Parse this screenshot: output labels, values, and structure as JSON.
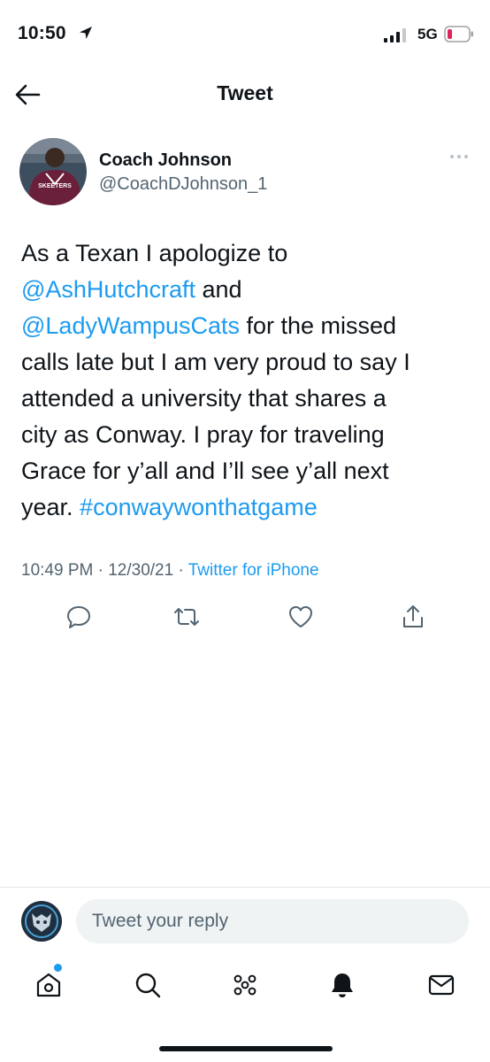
{
  "status_bar": {
    "time": "10:50",
    "network": "5G",
    "colors": {
      "battery_low": "#e0245e"
    }
  },
  "header": {
    "title": "Tweet"
  },
  "tweet": {
    "author_name": "Coach Johnson",
    "author_handle": "@CoachDJohnson_1",
    "avatar_text": "SKEETERS",
    "lines": [
      [
        {
          "t": "As a Texan I apologize to"
        }
      ],
      [
        {
          "t": "@AshHutchcraft",
          "link": true
        },
        {
          "t": " and"
        }
      ],
      [
        {
          "t": "@LadyWampusCats",
          "link": true
        },
        {
          "t": " for the missed"
        }
      ],
      [
        {
          "t": "calls late but I am very proud to say I"
        }
      ],
      [
        {
          "t": "attended a university that shares a"
        }
      ],
      [
        {
          "t": "city as Conway.  I pray for traveling"
        }
      ],
      [
        {
          "t": "Grace for y’all and I’ll see y’all next"
        }
      ],
      [
        {
          "t": "year. "
        },
        {
          "t": "#conwaywonthatgame",
          "link": true
        }
      ]
    ],
    "timestamp": "10:49 PM · 12/30/21 · ",
    "source": "Twitter for iPhone"
  },
  "actions": [
    "reply-icon",
    "retweet-icon",
    "like-icon",
    "share-icon"
  ],
  "reply_bar": {
    "placeholder": "Tweet your reply"
  },
  "tabs": [
    "home-icon",
    "search-icon",
    "spaces-icon",
    "notifications-icon",
    "messages-icon"
  ],
  "colors": {
    "accent": "#1d9bf0",
    "text": "#0f1419",
    "muted": "#536471",
    "input_bg": "#eff3f4"
  }
}
